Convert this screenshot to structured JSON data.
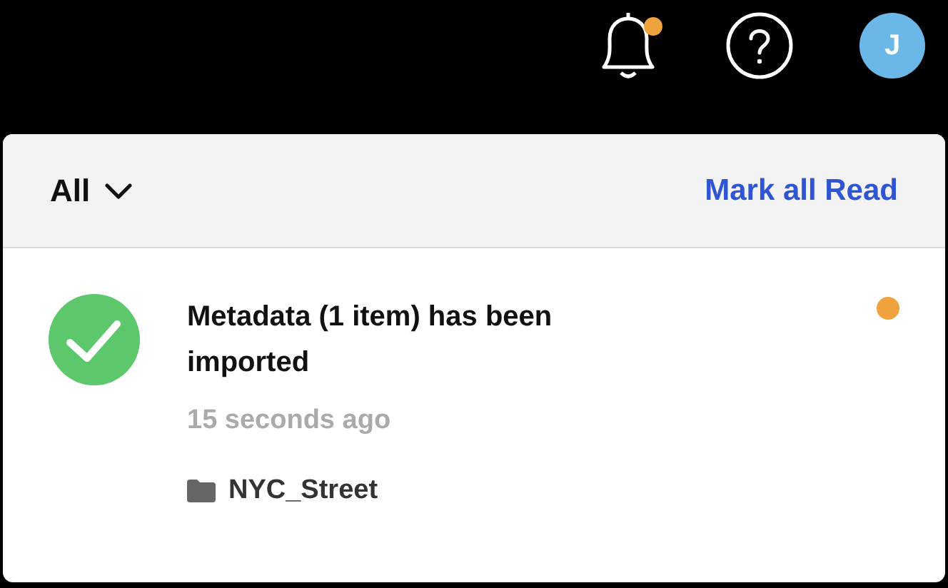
{
  "top_bar": {
    "notifications_unread": true,
    "avatar_initial": "J"
  },
  "panel": {
    "filter": "All",
    "mark_all": "Mark all Read",
    "notifications": [
      {
        "kind": "success",
        "title": "Metadata (1 item) has been imported",
        "time": "15 seconds ago",
        "folder": "NYC_Street",
        "unread": true
      }
    ]
  }
}
